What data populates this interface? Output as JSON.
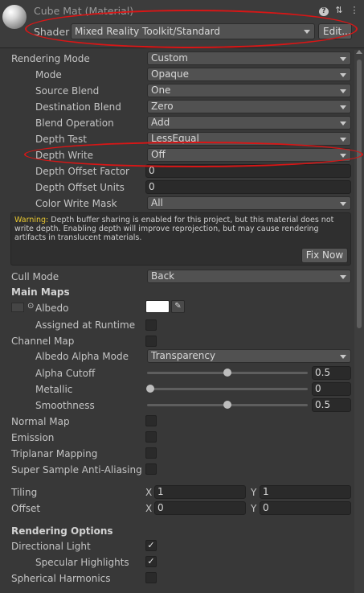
{
  "header": {
    "title": "Cube Mat (Material)",
    "shader_label": "Shader",
    "shader_value": "Mixed Reality Toolkit/Standard",
    "edit_label": "Edit...",
    "icons": [
      "help-icon",
      "presets-icon",
      "more-icon"
    ]
  },
  "rendering_mode": {
    "label": "Rendering Mode",
    "value": "Custom"
  },
  "mode": {
    "label": "Mode",
    "value": "Opaque"
  },
  "source_blend": {
    "label": "Source Blend",
    "value": "One"
  },
  "destination_blend": {
    "label": "Destination Blend",
    "value": "Zero"
  },
  "blend_operation": {
    "label": "Blend Operation",
    "value": "Add"
  },
  "depth_test": {
    "label": "Depth Test",
    "value": "LessEqual"
  },
  "depth_write": {
    "label": "Depth Write",
    "value": "Off"
  },
  "depth_offset_factor": {
    "label": "Depth Offset Factor",
    "value": "0"
  },
  "depth_offset_units": {
    "label": "Depth Offset Units",
    "value": "0"
  },
  "color_write_mask": {
    "label": "Color Write Mask",
    "value": "All"
  },
  "warning": {
    "prefix": "Warning:",
    "text": " Depth buffer sharing is enabled for this project, but this material does not write depth. Enabling depth will improve reprojection, but may cause rendering artifacts in translucent materials.",
    "fix_label": "Fix Now"
  },
  "cull_mode": {
    "label": "Cull Mode",
    "value": "Back"
  },
  "main_maps": {
    "label": "Main Maps"
  },
  "albedo": {
    "label": "Albedo",
    "color": "#ffffff"
  },
  "assigned_at_runtime": {
    "label": "Assigned at Runtime",
    "checked": false
  },
  "channel_map": {
    "label": "Channel Map",
    "checked": false
  },
  "albedo_alpha_mode": {
    "label": "Albedo Alpha Mode",
    "value": "Transparency"
  },
  "alpha_cutoff": {
    "label": "Alpha Cutoff",
    "value": "0.5",
    "level": 0.5
  },
  "metallic": {
    "label": "Metallic",
    "value": "0",
    "level": 0
  },
  "smoothness": {
    "label": "Smoothness",
    "value": "0.5",
    "level": 0.5
  },
  "normal_map": {
    "label": "Normal Map",
    "checked": false
  },
  "emission": {
    "label": "Emission",
    "checked": false
  },
  "triplanar_mapping": {
    "label": "Triplanar Mapping",
    "checked": false
  },
  "ssaa": {
    "label": "Super Sample Anti-Aliasing",
    "checked": false
  },
  "tiling": {
    "label": "Tiling",
    "x_label": "X",
    "x": "1",
    "y_label": "Y",
    "y": "1"
  },
  "offset": {
    "label": "Offset",
    "x_label": "X",
    "x": "0",
    "y_label": "Y",
    "y": "0"
  },
  "rendering_options": {
    "label": "Rendering Options"
  },
  "directional_light": {
    "label": "Directional Light",
    "checked": true
  },
  "specular_highlights": {
    "label": "Specular Highlights",
    "checked": true
  },
  "spherical_harmonics": {
    "label": "Spherical Harmonics",
    "checked": false
  },
  "annotation_color": "#d81616"
}
